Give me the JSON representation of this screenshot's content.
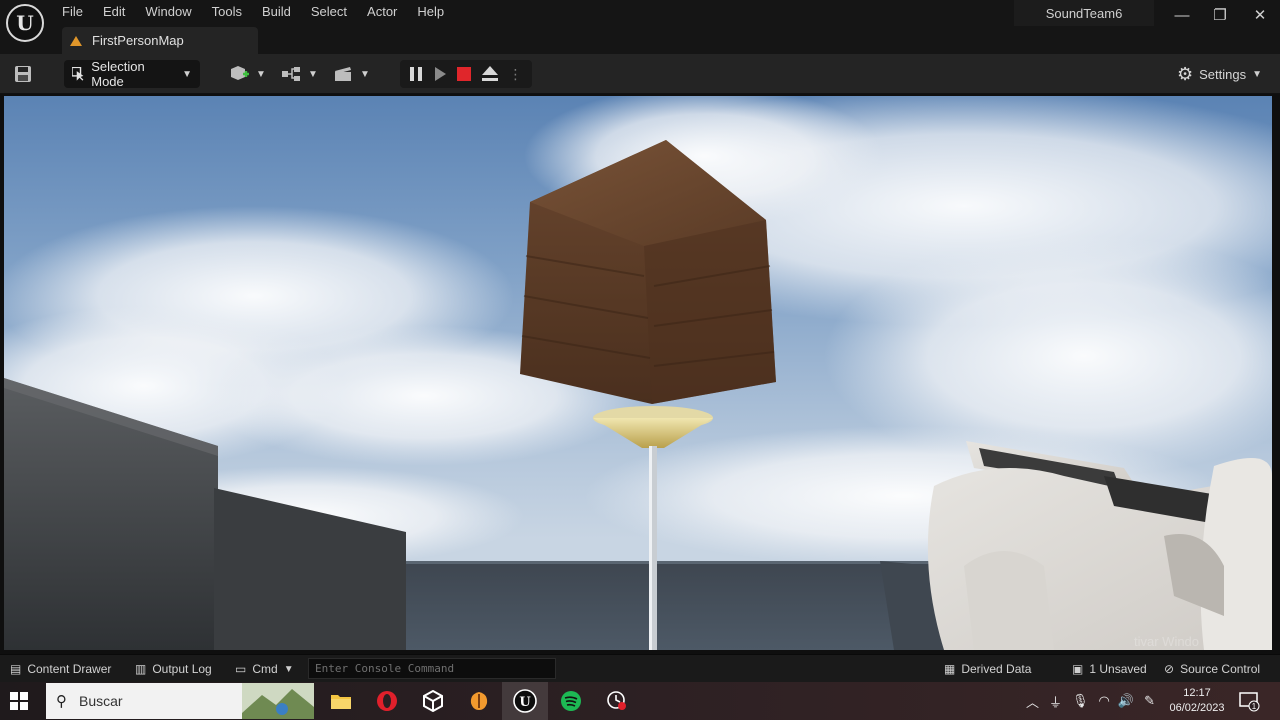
{
  "app": {
    "logo_letter": "U",
    "project": "SoundTeam6",
    "menu": [
      "File",
      "Edit",
      "Window",
      "Tools",
      "Build",
      "Select",
      "Actor",
      "Help"
    ],
    "window_controls": {
      "minimize": "—",
      "restore": "❐",
      "close": "✕"
    },
    "tab_label": "FirstPersonMap"
  },
  "toolbar": {
    "selection_mode": "Selection Mode",
    "settings": "Settings"
  },
  "viewport": {
    "scene": "first-person play-in-editor view"
  },
  "statusbar": {
    "content_drawer": "Content Drawer",
    "output_log": "Output Log",
    "cmd": "Cmd",
    "console_placeholder": "Enter Console Command",
    "derived_data": "Derived Data",
    "unsaved": "1 Unsaved",
    "source_control": "Source Control"
  },
  "taskbar": {
    "search_placeholder": "Buscar",
    "time": "12:17",
    "date": "06/02/2023",
    "notification_count": "1"
  },
  "colors": {
    "stop": "#e0262b",
    "warning_tab": "#e0962a",
    "spotify": "#1db954",
    "opera": "#e0202b"
  }
}
